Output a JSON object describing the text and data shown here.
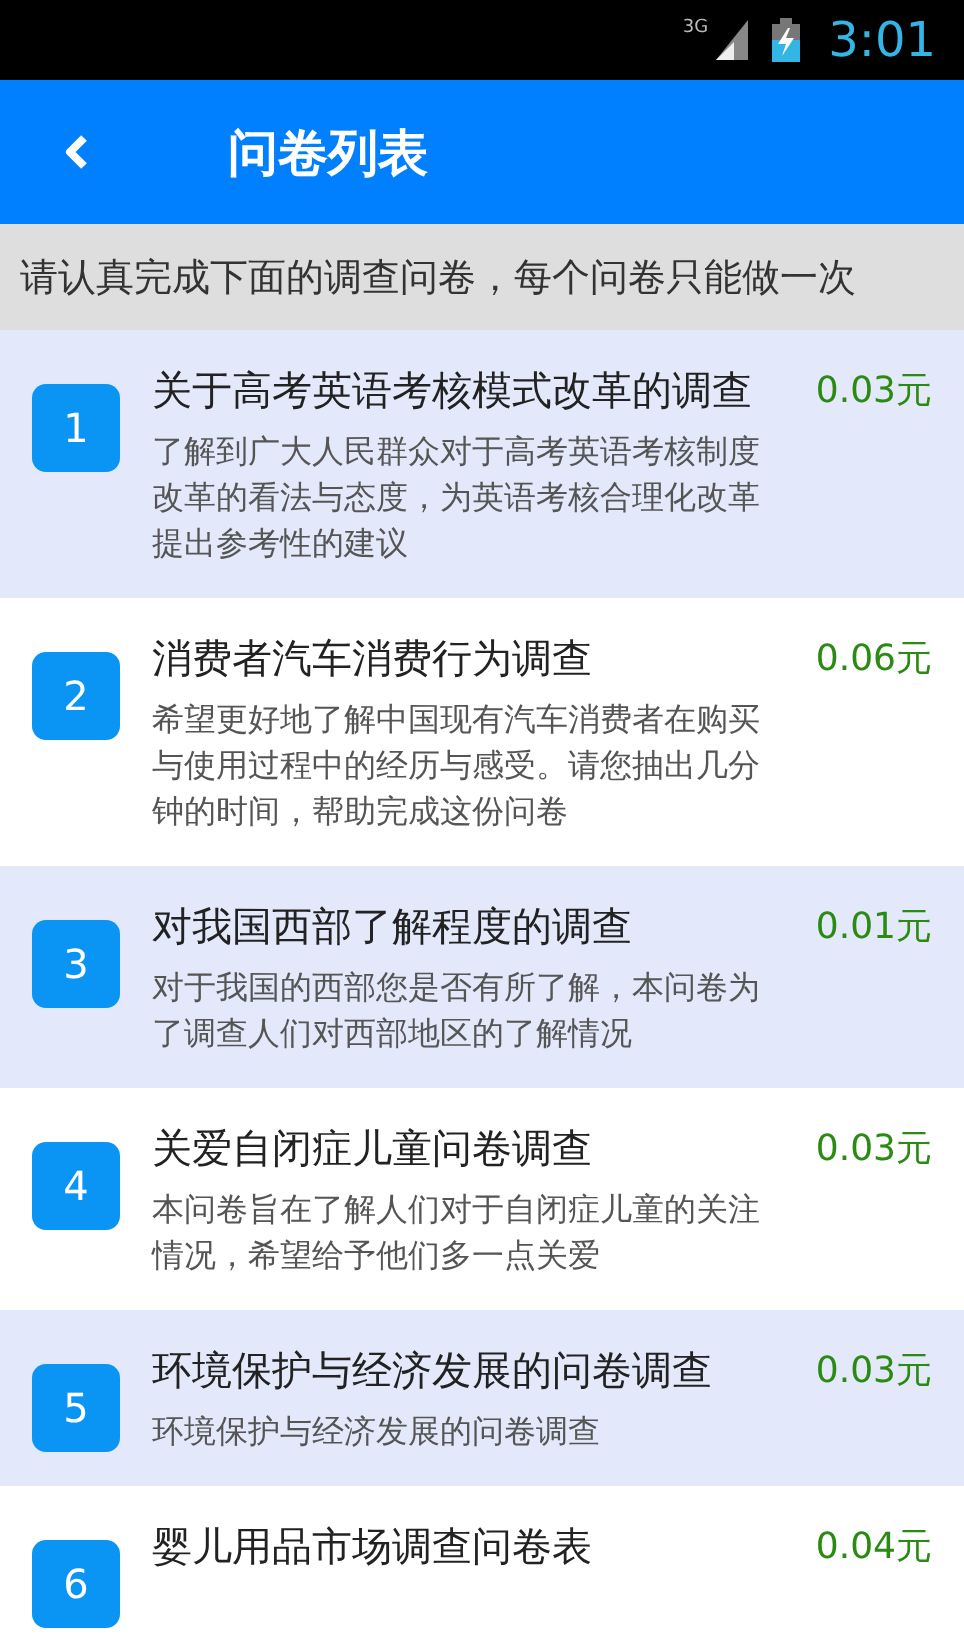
{
  "status_bar": {
    "network": "3G",
    "time": "3:01"
  },
  "header": {
    "title": "问卷列表"
  },
  "notice": "请认真完成下面的调查问卷，每个问卷只能做一次",
  "surveys": [
    {
      "number": "1",
      "title": "关于高考英语考核模式改革的调查",
      "description": "了解到广大人民群众对于高考英语考核制度改革的看法与态度，为英语考核合理化改革提出参考性的建议",
      "reward": "0.03元"
    },
    {
      "number": "2",
      "title": "消费者汽车消费行为调查",
      "description": "希望更好地了解中国现有汽车消费者在购买与使用过程中的经历与感受。请您抽出几分钟的时间，帮助完成这份问卷",
      "reward": "0.06元"
    },
    {
      "number": "3",
      "title": "对我国西部了解程度的调查",
      "description": "对于我国的西部您是否有所了解，本问卷为了调查人们对西部地区的了解情况",
      "reward": "0.01元"
    },
    {
      "number": "4",
      "title": "关爱自闭症儿童问卷调查",
      "description": "本问卷旨在了解人们对于自闭症儿童的关注情况，希望给予他们多一点关爱",
      "reward": "0.03元"
    },
    {
      "number": "5",
      "title": "环境保护与经济发展的问卷调查",
      "description": "环境保护与经济发展的问卷调查",
      "reward": "0.03元"
    },
    {
      "number": "6",
      "title": "婴儿用品市场调查问卷表",
      "reward": "0.04元"
    }
  ]
}
